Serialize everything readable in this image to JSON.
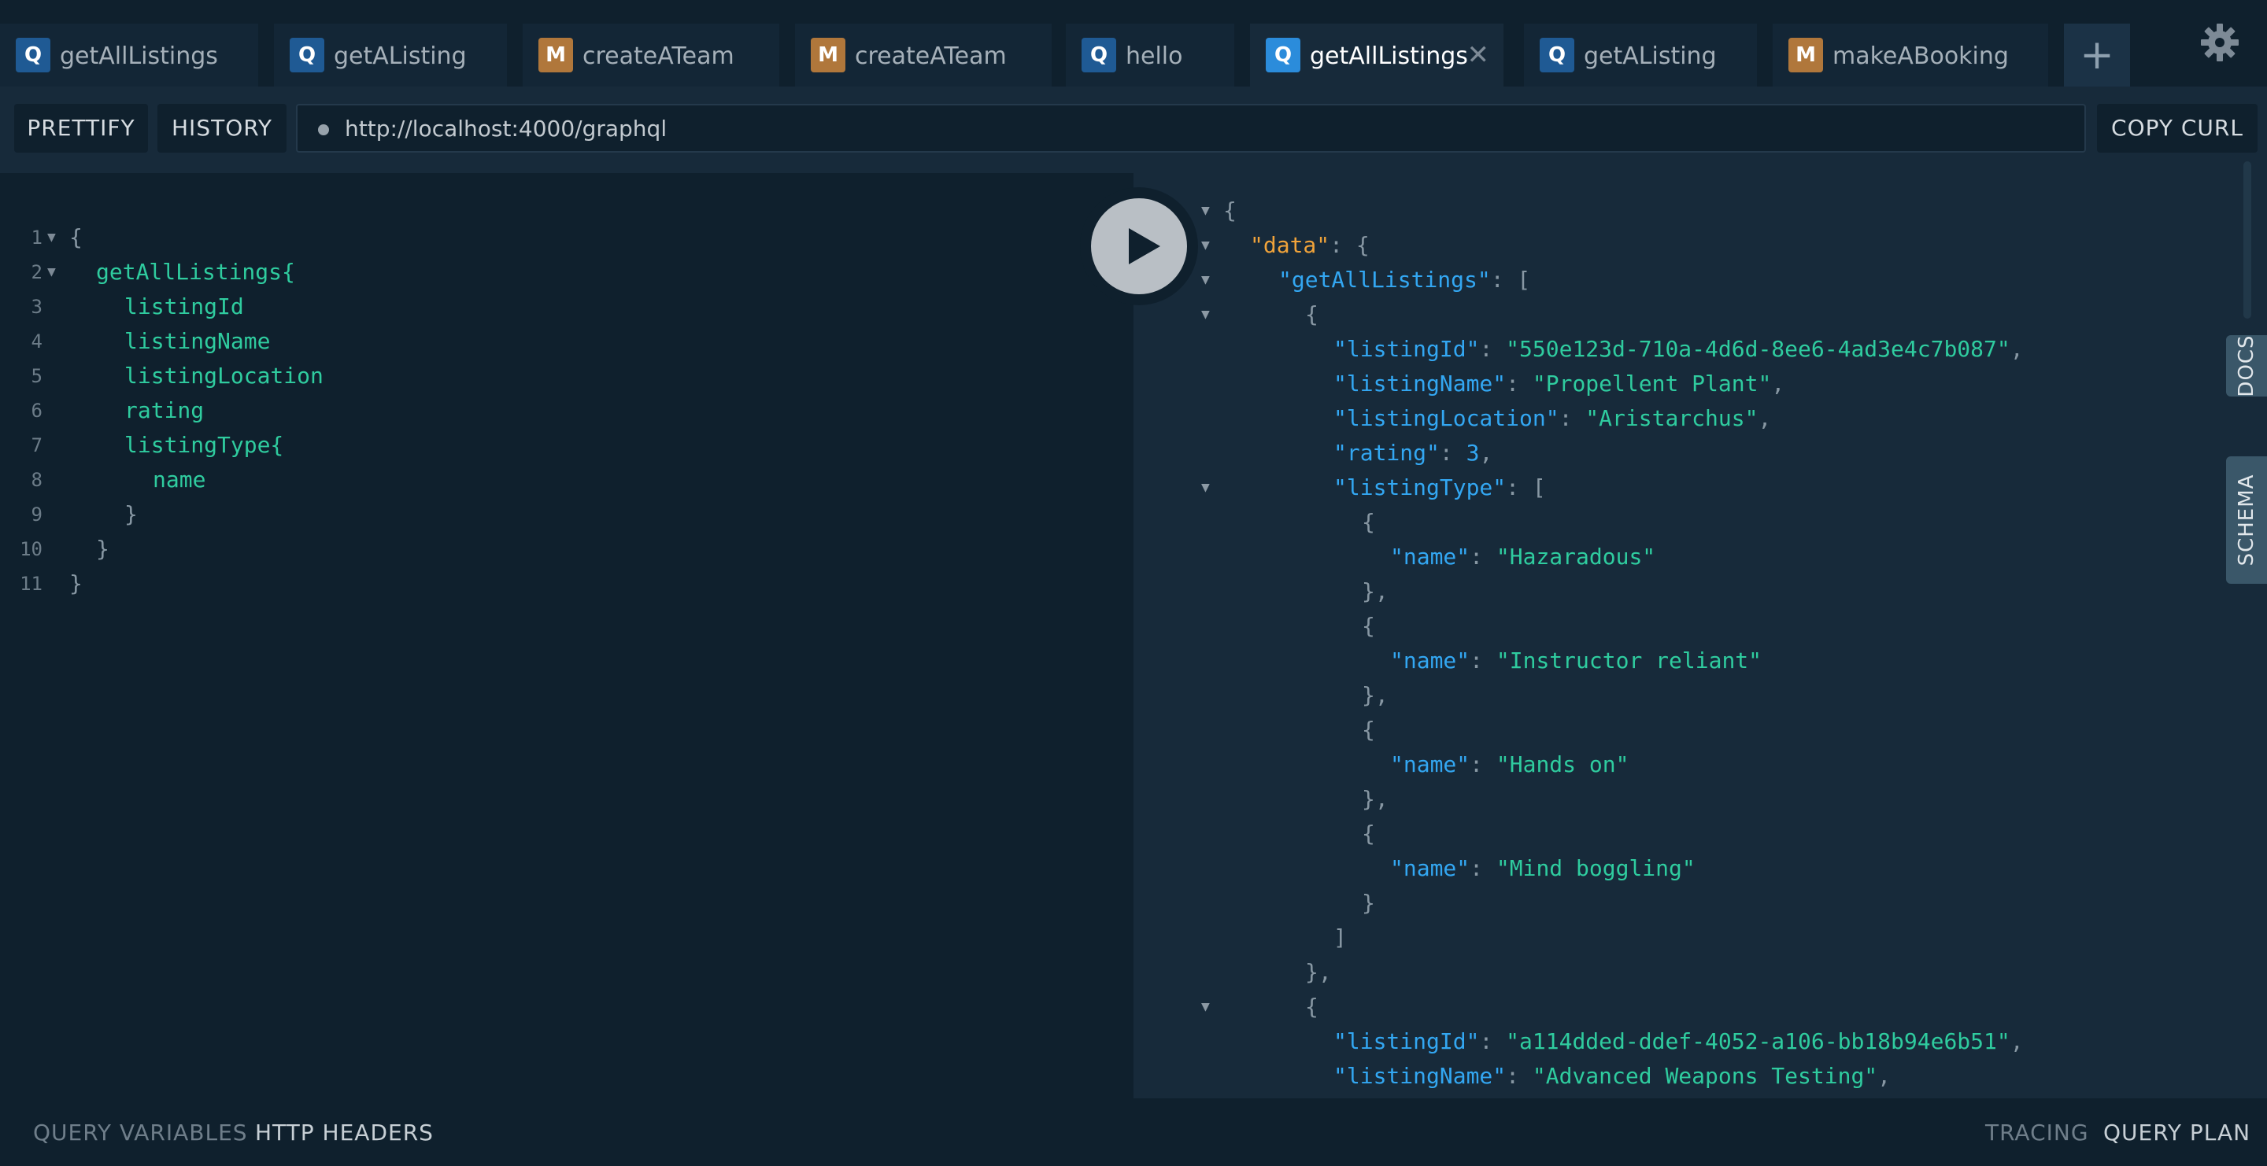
{
  "tabs": [
    {
      "type": "Q",
      "label": "getAllListings",
      "active": false
    },
    {
      "type": "Q",
      "label": "getAListing",
      "active": false
    },
    {
      "type": "M",
      "label": "createATeam",
      "active": false
    },
    {
      "type": "M",
      "label": "createATeam",
      "active": false
    },
    {
      "type": "Q",
      "label": "hello",
      "active": false
    },
    {
      "type": "Q",
      "label": "getAllListings",
      "active": true
    },
    {
      "type": "Q",
      "label": "getAListing",
      "active": false
    },
    {
      "type": "M",
      "label": "makeABooking",
      "active": false
    }
  ],
  "tab_close_glyph": "✕",
  "add_tab_glyph": "+",
  "toolbar": {
    "prettify_label": "PRETTIFY",
    "history_label": "HISTORY",
    "url": "http://localhost:4000/graphql",
    "copy_curl_label": "COPY CURL"
  },
  "editor": {
    "lines": [
      {
        "n": "1",
        "text": "{",
        "fold": true
      },
      {
        "n": "2",
        "text": "getAllListings{",
        "fold": true
      },
      {
        "n": "3",
        "text": "listingId",
        "fold": false
      },
      {
        "n": "4",
        "text": "listingName",
        "fold": false
      },
      {
        "n": "5",
        "text": "listingLocation",
        "fold": false
      },
      {
        "n": "6",
        "text": "rating",
        "fold": false
      },
      {
        "n": "7",
        "text": "listingType{",
        "fold": false
      },
      {
        "n": "8",
        "text": "name",
        "fold": false
      },
      {
        "n": "9",
        "text": "}",
        "fold": false
      },
      {
        "n": "10",
        "text": "}",
        "fold": false
      },
      {
        "n": "11",
        "text": "}",
        "fold": false
      }
    ]
  },
  "result": {
    "lines": [
      {
        "parts": [
          [
            "pu",
            "{"
          ]
        ],
        "fold": true
      },
      {
        "parts": [
          [
            "kd",
            "\"data\""
          ],
          [
            "pu",
            ": {"
          ]
        ],
        "fold": true
      },
      {
        "parts": [
          [
            "k",
            "\"getAllListings\""
          ],
          [
            "pu",
            ": ["
          ]
        ],
        "fold": true
      },
      {
        "parts": [
          [
            "pu",
            "{"
          ]
        ],
        "fold": true
      },
      {
        "parts": [
          [
            "k",
            "\"listingId\""
          ],
          [
            "pu",
            ": "
          ],
          [
            "s",
            "\"550e123d-710a-4d6d-8ee6-4ad3e4c7b087\""
          ],
          [
            "pu",
            ","
          ]
        ],
        "fold": false
      },
      {
        "parts": [
          [
            "k",
            "\"listingName\""
          ],
          [
            "pu",
            ": "
          ],
          [
            "s",
            "\"Propellent Plant\""
          ],
          [
            "pu",
            ","
          ]
        ],
        "fold": false
      },
      {
        "parts": [
          [
            "k",
            "\"listingLocation\""
          ],
          [
            "pu",
            ": "
          ],
          [
            "s",
            "\"Aristarchus\""
          ],
          [
            "pu",
            ","
          ]
        ],
        "fold": false
      },
      {
        "parts": [
          [
            "k",
            "\"rating\""
          ],
          [
            "pu",
            ": "
          ],
          [
            "n",
            "3"
          ],
          [
            "pu",
            ","
          ]
        ],
        "fold": false
      },
      {
        "parts": [
          [
            "k",
            "\"listingType\""
          ],
          [
            "pu",
            ": ["
          ]
        ],
        "fold": true
      },
      {
        "parts": [
          [
            "pu",
            "{"
          ]
        ],
        "fold": false
      },
      {
        "parts": [
          [
            "k",
            "\"name\""
          ],
          [
            "pu",
            ": "
          ],
          [
            "s",
            "\"Hazaradous\""
          ]
        ],
        "fold": false
      },
      {
        "parts": [
          [
            "pu",
            "},"
          ]
        ],
        "fold": false
      },
      {
        "parts": [
          [
            "pu",
            "{"
          ]
        ],
        "fold": false
      },
      {
        "parts": [
          [
            "k",
            "\"name\""
          ],
          [
            "pu",
            ": "
          ],
          [
            "s",
            "\"Instructor reliant\""
          ]
        ],
        "fold": false
      },
      {
        "parts": [
          [
            "pu",
            "},"
          ]
        ],
        "fold": false
      },
      {
        "parts": [
          [
            "pu",
            "{"
          ]
        ],
        "fold": false
      },
      {
        "parts": [
          [
            "k",
            "\"name\""
          ],
          [
            "pu",
            ": "
          ],
          [
            "s",
            "\"Hands on\""
          ]
        ],
        "fold": false
      },
      {
        "parts": [
          [
            "pu",
            "},"
          ]
        ],
        "fold": false
      },
      {
        "parts": [
          [
            "pu",
            "{"
          ]
        ],
        "fold": false
      },
      {
        "parts": [
          [
            "k",
            "\"name\""
          ],
          [
            "pu",
            ": "
          ],
          [
            "s",
            "\"Mind boggling\""
          ]
        ],
        "fold": false
      },
      {
        "parts": [
          [
            "pu",
            "}"
          ]
        ],
        "fold": false
      },
      {
        "parts": [
          [
            "pu",
            "]"
          ]
        ],
        "fold": false
      },
      {
        "parts": [
          [
            "pu",
            "},"
          ]
        ],
        "fold": false
      },
      {
        "parts": [
          [
            "pu",
            "{"
          ]
        ],
        "fold": true
      },
      {
        "parts": [
          [
            "k",
            "\"listingId\""
          ],
          [
            "pu",
            ": "
          ],
          [
            "s",
            "\"a114dded-ddef-4052-a106-bb18b94e6b51\""
          ],
          [
            "pu",
            ","
          ]
        ],
        "fold": false
      },
      {
        "parts": [
          [
            "k",
            "\"listingName\""
          ],
          [
            "pu",
            ": "
          ],
          [
            "s",
            "\"Advanced Weapons Testing\""
          ],
          [
            "pu",
            ","
          ]
        ],
        "fold": false
      }
    ]
  },
  "side_tabs": {
    "docs": "DOCS",
    "schema": "SCHEMA"
  },
  "bottom": {
    "query_variables": "QUERY VARIABLES",
    "http_headers": "HTTP HEADERS",
    "tracing": "TRACING",
    "query_plan": "QUERY PLAN"
  },
  "icons": {
    "settings": "gear-icon",
    "run": "play-icon",
    "fold": "triangle-down-icon"
  },
  "colors": {
    "background": "#172a3a",
    "panel": "#0f202d",
    "query_badge": "#1f5a94",
    "mutation_badge": "#b0773b",
    "key": "#33a7f2",
    "string": "#2fcc9f",
    "data_key": "#f0a33a"
  }
}
